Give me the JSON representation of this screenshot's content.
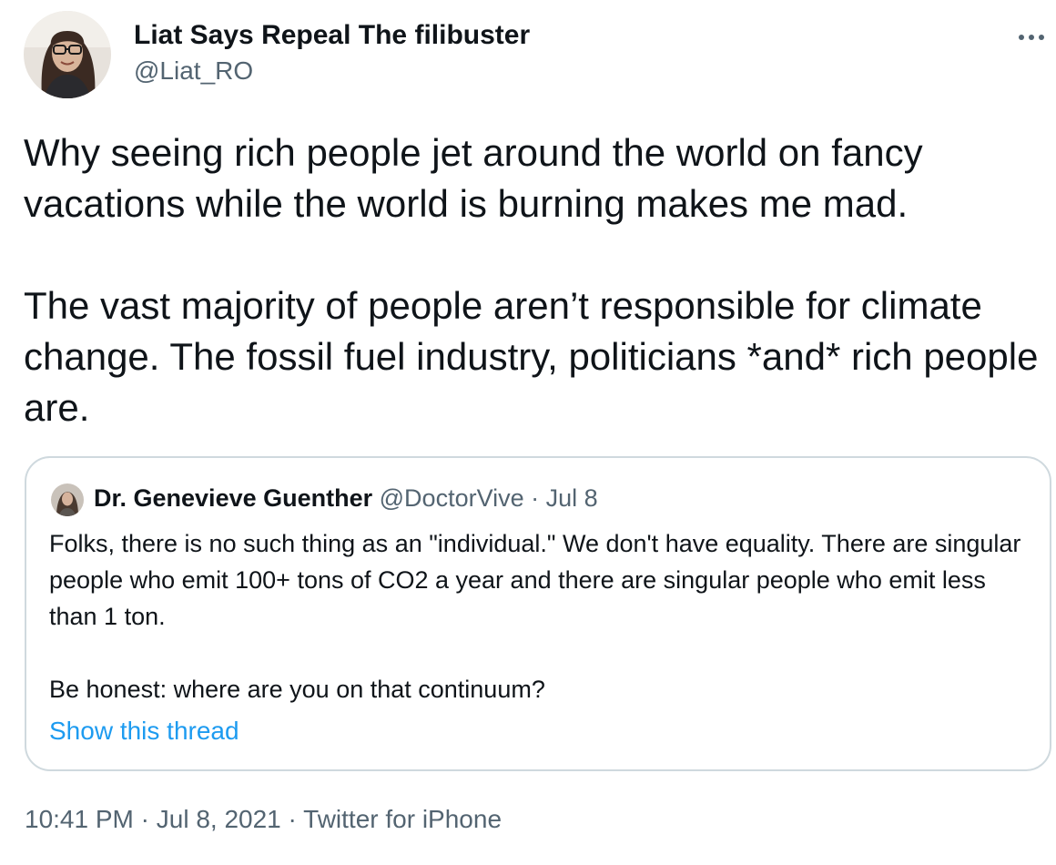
{
  "author": {
    "name": "Liat Says Repeal The filibuster",
    "handle": "@Liat_RO"
  },
  "tweet": {
    "paragraph1": "Why seeing rich people jet around the world on fancy vacations while the world is burning makes me mad.",
    "paragraph2": "The vast majority of people aren’t responsible for climate change. The fossil fuel industry, politicians *and* rich people are."
  },
  "quoted_tweet": {
    "name": "Dr. Genevieve Guenther",
    "handle": "@DoctorVive",
    "separator": "·",
    "date": "Jul 8",
    "paragraph1": "Folks, there is no such thing as an \"individual.\" We don't have equality. There are singular people who emit 100+ tons of CO2 a year and there are singular people who emit less than 1 ton.",
    "paragraph2": "Be honest: where are you on that continuum?",
    "show_thread_label": "Show this thread"
  },
  "meta": {
    "time": "10:41 PM",
    "separator": "·",
    "date": "Jul 8, 2021",
    "source": "Twitter for iPhone"
  },
  "icons": {
    "more": "more-horizontal-icon"
  },
  "colors": {
    "text_primary": "#0f1419",
    "text_secondary": "#536471",
    "link": "#1d9bf0",
    "border": "#cfd9de"
  }
}
